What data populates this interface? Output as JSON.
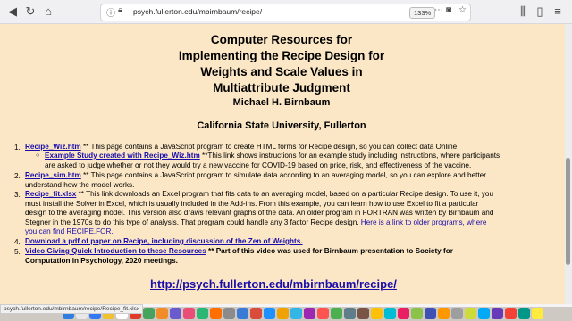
{
  "browser": {
    "url": "psych.fullerton.edu/mbirnbaum/recipe/",
    "zoom": "133%"
  },
  "page": {
    "title": "Computer Resources for\nImplementing the Recipe Design for\nWeights and Scale Values in\nMultiattribute Judgment",
    "author": "Michael H. Birnbaum",
    "affiliation": "California State University, Fullerton",
    "items": [
      {
        "num": "1.",
        "link": "Recipe_Wiz.htm",
        "text1": " ** This page contains a JavaScript program to create HTML forms for Recipe design, so you can collect data Online."
      },
      {
        "link": "Example Study created with Recipe_Wiz.htm",
        "text1": " **This link shows instructions for an example study including instructions, where participants",
        "text2": "are asked to judge whether or not they would try a new vaccine for COVID-19 based on price, risk, and effectiveness of the vaccine."
      },
      {
        "num": "2.",
        "link": "Recipe_sim.htm",
        "text1": " ** This page contains a JavaScript program to simulate data according to an averaging model, so you can explore and better",
        "text2": "understand how the model works."
      },
      {
        "num": "3.",
        "link": "Recipe_fit.xlsx",
        "text1": " ** This link downloads an Excel program that fits data to an averaging model, based on a particular Recipe design. To use it, you",
        "text2": "must install the Solver in Excel, which is usually included in the Add-ins. From this example, you can learn how to use Excel to fit a particular",
        "text3": "design to the averaging model. This version also draws relevant graphs of the data. An older program in FORTRAN was written by Birnbaum and",
        "text4": "Stegner in the 1970s to do this type of analysis. That program could handle any 3 factor Recipe design. ",
        "link2": "Here is a link to older programs, where",
        "link2b": "you can find RECIPE.FOR."
      },
      {
        "num": "4.",
        "link": "Download a pdf of paper on Recipe, including discussion of the Zen of Weights."
      },
      {
        "num": "5.",
        "link": "Video Giving Quick Introduction to these Resources",
        "text1": " ** Part of this video was used for Birnbaum presentation to Society for",
        "text2": "Computation in Psychology, 2020 meetings."
      }
    ],
    "site_url": "http://psych.fullerton.edu/mbirnbaum/recipe/"
  },
  "status_text": "psych.fullerton.edu/mbirnbaum/recipe/Recipe_fit.xlsx",
  "dock_colors": [
    "#2f7de1",
    "#e8e8e8",
    "#3478f6",
    "#f2c12e",
    "#ffffff",
    "#e03b2a",
    "#46a35e",
    "#f28c28",
    "#6a5acd",
    "#e94e77",
    "#2bb673",
    "#ff6f00",
    "#8b8b8b",
    "#3a7bd5",
    "#d94b3b",
    "#1e90ff",
    "#f0a202",
    "#33b5e5",
    "#9c27b0",
    "#ff5252",
    "#4caf50",
    "#607d8b",
    "#795548",
    "#ffc107",
    "#00bcd4",
    "#e91e63",
    "#8bc34a",
    "#3f51b5",
    "#ff9800",
    "#9e9e9e",
    "#cddc39",
    "#03a9f4",
    "#673ab7",
    "#f44336",
    "#009688",
    "#ffeb3b"
  ]
}
